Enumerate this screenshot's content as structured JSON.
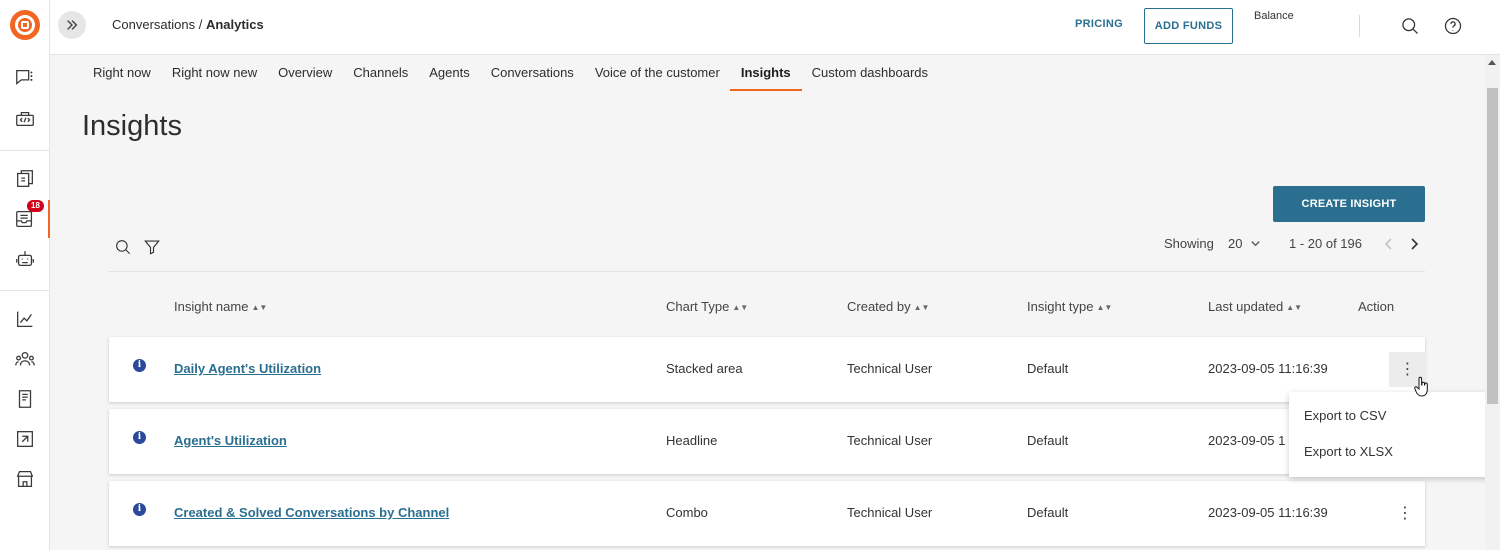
{
  "header": {
    "breadcrumb_parent": "Conversations",
    "breadcrumb_sep": " / ",
    "breadcrumb_current": "Analytics",
    "pricing": "PRICING",
    "add_funds": "ADD FUNDS",
    "balance_label": "Balance"
  },
  "sidebar": {
    "badge_count": "18",
    "icons": [
      "chat-icon",
      "code-icon",
      "layers-icon",
      "inbox-icon",
      "bot-icon",
      "chart-line-icon",
      "people-icon",
      "book-icon",
      "route-icon",
      "store-icon"
    ],
    "active_color": "#f26522"
  },
  "tabs": [
    {
      "label": "Right now"
    },
    {
      "label": "Right now new"
    },
    {
      "label": "Overview"
    },
    {
      "label": "Channels"
    },
    {
      "label": "Agents"
    },
    {
      "label": "Conversations"
    },
    {
      "label": "Voice of the customer"
    },
    {
      "label": "Insights",
      "active": true
    },
    {
      "label": "Custom dashboards"
    }
  ],
  "page": {
    "title": "Insights",
    "create_button": "CREATE INSIGHT"
  },
  "pagination": {
    "showing_label": "Showing",
    "page_size": "20",
    "range": "1 - 20 of 196"
  },
  "table": {
    "columns": [
      "Insight name",
      "Chart Type",
      "Created by",
      "Insight type",
      "Last updated",
      "Action"
    ],
    "rows": [
      {
        "name": "Daily Agent's Utilization",
        "chart_type": "Stacked area",
        "created_by": "Technical User",
        "insight_type": "Default",
        "last_updated": "2023-09-05 11:16:39"
      },
      {
        "name": "Agent's Utilization",
        "chart_type": "Headline",
        "created_by": "Technical User",
        "insight_type": "Default",
        "last_updated": "2023-09-05 1"
      },
      {
        "name": "Created & Solved Conversations by Channel",
        "chart_type": "Combo",
        "created_by": "Technical User",
        "insight_type": "Default",
        "last_updated": "2023-09-05 11:16:39"
      }
    ]
  },
  "action_menu": {
    "items": [
      "Export to CSV",
      "Export to XLSX"
    ]
  },
  "colors": {
    "accent": "#f26522",
    "primary": "#2a6f8f",
    "info": "#2c4a9c",
    "badge": "#d0021b"
  }
}
